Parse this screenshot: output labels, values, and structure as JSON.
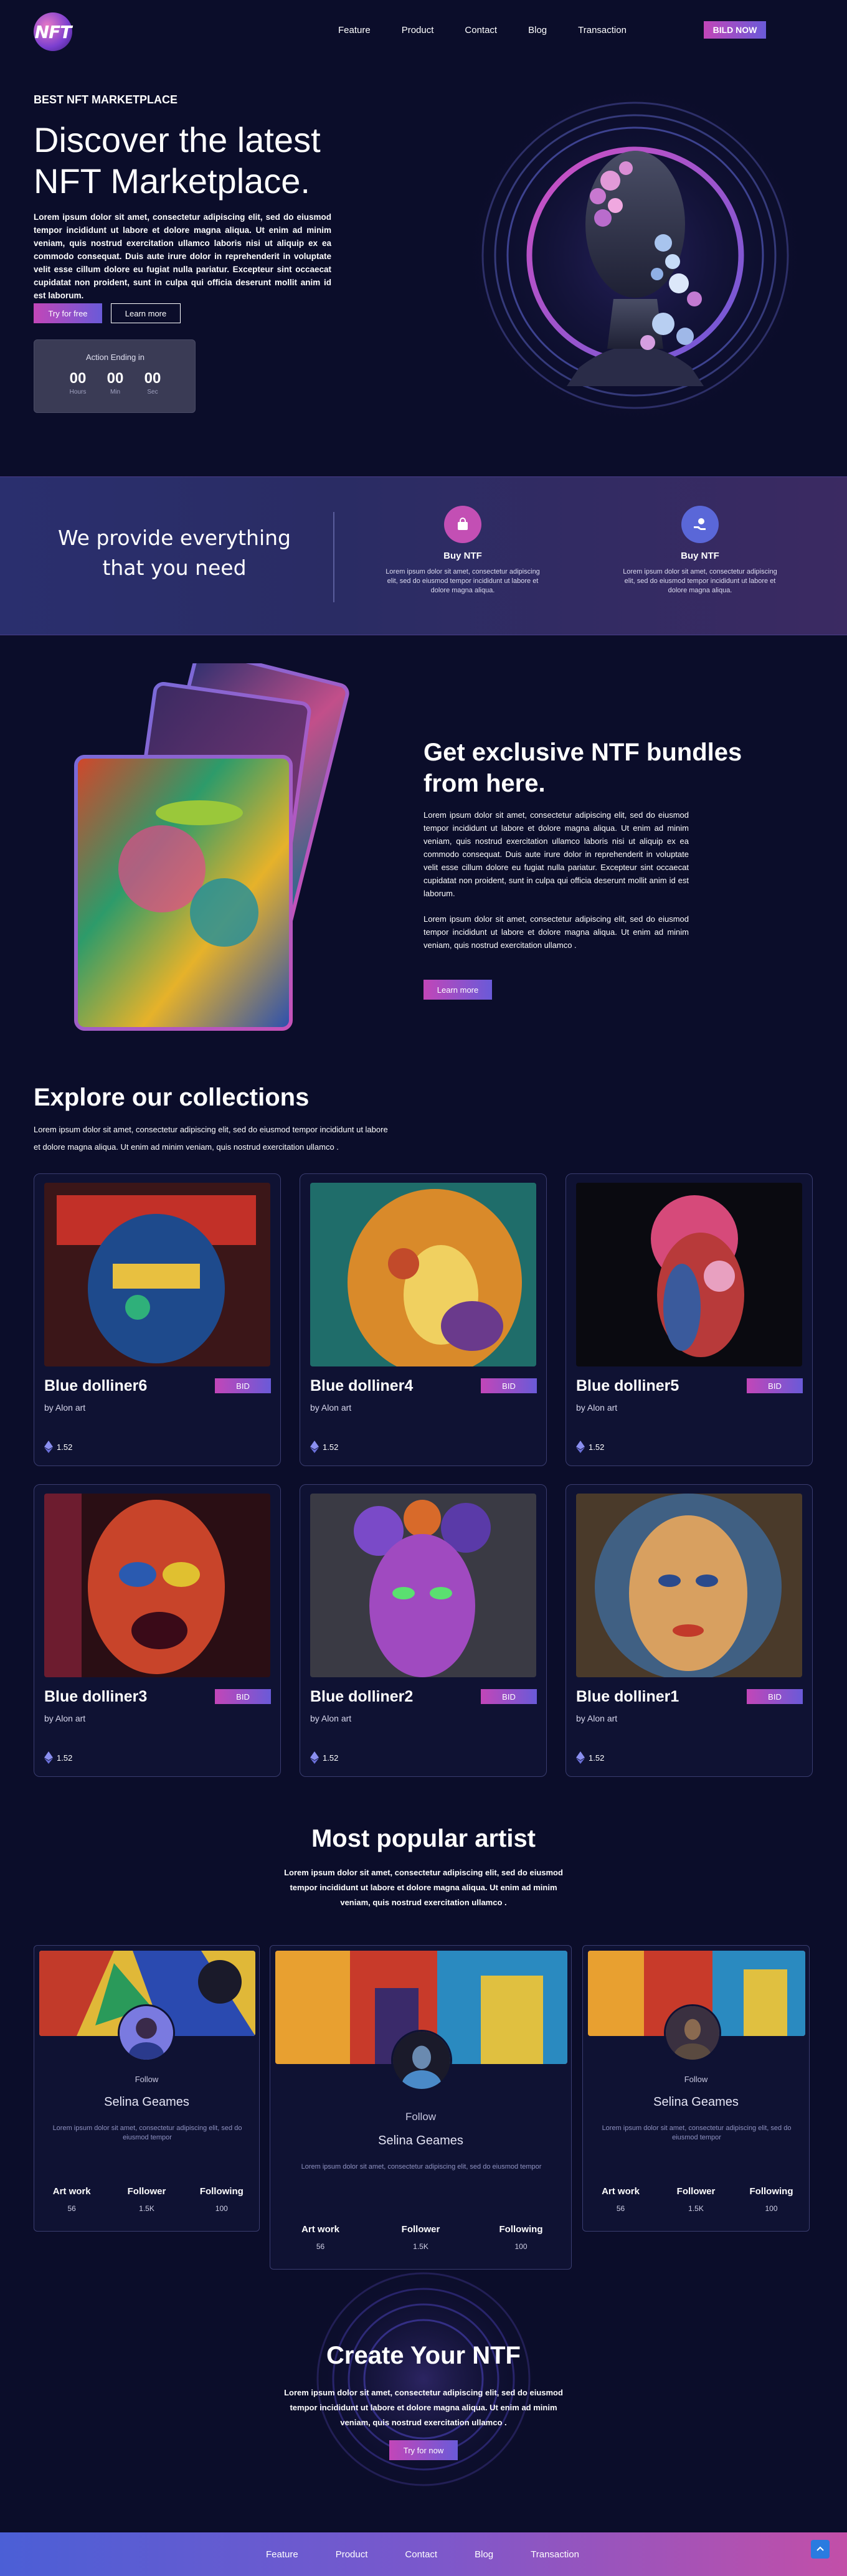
{
  "nav": {
    "logo_text": "NFT",
    "links": [
      "Feature",
      "Product",
      "Contact",
      "Blog",
      "Transaction"
    ],
    "cta": "BILD NOW"
  },
  "hero": {
    "eyebrow": "BEST NFT MARKETPLACE",
    "title": "Discover the latest NFT Marketplace.",
    "text": "Lorem ipsum dolor sit amet, consectetur adipiscing elit, sed do eiusmod tempor incididunt ut labore et dolore magna aliqua. Ut enim ad minim veniam, quis nostrud exercitation ullamco laboris nisi ut aliquip ex ea commodo consequat. Duis aute irure dolor in reprehenderit in voluptate velit esse cillum dolore eu fugiat nulla pariatur. Excepteur sint occaecat cupidatat non proident, sunt in culpa qui officia deserunt mollit anim id est laborum.",
    "btn_primary": "Try for free",
    "btn_secondary": "Learn more",
    "auction": {
      "title": "Action Ending in",
      "hours": "00",
      "hours_label": "Hours",
      "min": "00",
      "min_label": "Min",
      "sec": "00",
      "sec_label": "Sec"
    }
  },
  "band": {
    "title": "We provide everything that you need",
    "features": [
      {
        "title": "Buy NTF",
        "icon": "shopping-bag-icon",
        "text": "Lorem ipsum dolor sit amet, consectetur adipiscing elit, sed do eiusmod tempor incididunt ut labore et dolore magna aliqua."
      },
      {
        "title": "Buy NTF",
        "icon": "hand-coin-icon",
        "text": "Lorem ipsum dolor sit amet, consectetur adipiscing elit, sed do eiusmod tempor incididunt ut labore et dolore magna aliqua."
      }
    ]
  },
  "bundles": {
    "title": "Get exclusive NTF bundles from here.",
    "p1": "Lorem ipsum dolor sit amet, consectetur adipiscing elit, sed do eiusmod tempor incididunt ut labore et dolore magna aliqua. Ut enim ad minim veniam, quis nostrud exercitation ullamco laboris nisi ut aliquip ex ea commodo consequat. Duis aute irure dolor in reprehenderit in voluptate velit esse cillum dolore eu fugiat nulla pariatur. Excepteur sint occaecat cupidatat non proident, sunt in culpa qui officia deserunt mollit anim id est laborum.",
    "p2": "Lorem ipsum dolor sit amet, consectetur adipiscing elit, sed do eiusmod tempor incididunt ut labore et dolore magna aliqua. Ut enim ad minim veniam, quis nostrud exercitation ullamco .",
    "btn": "Learn more"
  },
  "collections": {
    "title": "Explore our collections",
    "text": "Lorem ipsum dolor sit amet, consectetur adipiscing elit, sed do eiusmod tempor incididunt ut labore et dolore magna aliqua. Ut enim ad minim veniam, quis nostrud exercitation ullamco .",
    "items": [
      {
        "name": "Blue dolliner6",
        "by": "by Alon art",
        "bid": "BID",
        "price": "1.52"
      },
      {
        "name": "Blue dolliner4",
        "by": "by Alon art",
        "bid": "BID",
        "price": "1.52"
      },
      {
        "name": "Blue dolliner5",
        "by": "by Alon art",
        "bid": "BID",
        "price": "1.52"
      },
      {
        "name": "Blue dolliner3",
        "by": "by Alon art",
        "bid": "BID",
        "price": "1.52"
      },
      {
        "name": "Blue dolliner2",
        "by": "by Alon art",
        "bid": "BID",
        "price": "1.52"
      },
      {
        "name": "Blue dolliner1",
        "by": "by Alon art",
        "bid": "BID",
        "price": "1.52"
      }
    ]
  },
  "artists": {
    "title": "Most popular artist",
    "text": "Lorem ipsum dolor sit amet, consectetur adipiscing elit, sed do eiusmod tempor incididunt ut labore et dolore magna aliqua. Ut enim ad minim veniam, quis nostrud exercitation ullamco .",
    "cards": [
      {
        "follow": "Follow",
        "name": "Selina Geames",
        "desc": "Lorem ipsum dolor sit amet, consectetur adipiscing elit, sed do eiusmod tempor",
        "k1": "Art work",
        "v1": "56",
        "k2": "Follower",
        "v2": "1.5K",
        "k3": "Following",
        "v3": "100"
      },
      {
        "follow": "Follow",
        "name": "Selina Geames",
        "desc": "Lorem ipsum dolor sit amet, consectetur adipiscing elit, sed do eiusmod tempor",
        "k1": "Art work",
        "v1": "56",
        "k2": "Follower",
        "v2": "1.5K",
        "k3": "Following",
        "v3": "100"
      },
      {
        "follow": "Follow",
        "name": "Selina Geames",
        "desc": "Lorem ipsum dolor sit amet, consectetur adipiscing elit, sed do eiusmod tempor",
        "k1": "Art work",
        "v1": "56",
        "k2": "Follower",
        "v2": "1.5K",
        "k3": "Following",
        "v3": "100"
      }
    ]
  },
  "create": {
    "title": "Create Your NTF",
    "text": "Lorem ipsum dolor sit amet, consectetur adipiscing elit, sed do eiusmod tempor incididunt ut labore et dolore magna aliqua. Ut enim ad minim veniam, quis nostrud exercitation ullamco .",
    "btn": "Try for now"
  },
  "footer": {
    "links": [
      "Feature",
      "Product",
      "Contact",
      "Blog",
      "Transaction"
    ],
    "to_top_icon": "arrow-up-icon"
  },
  "colors": {
    "background": "#0b0d2a",
    "accent_pink": "#c246b8",
    "accent_violet": "#6a5ad8"
  }
}
